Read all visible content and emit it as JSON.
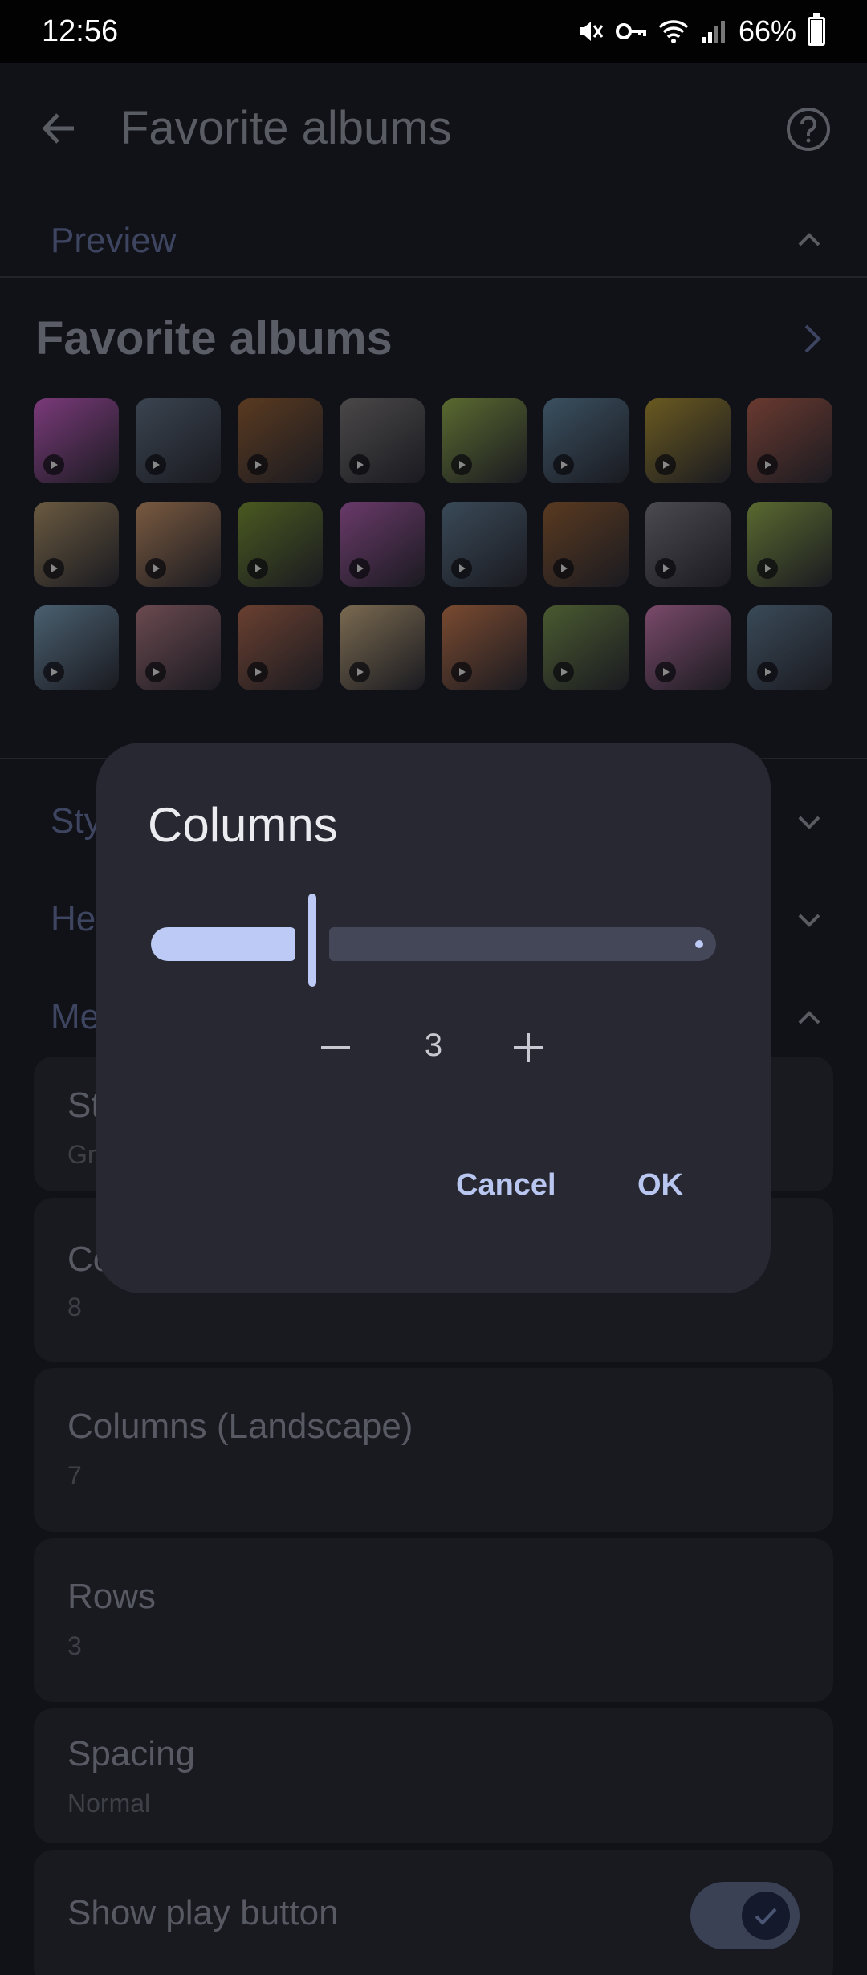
{
  "status_bar": {
    "time": "12:56",
    "battery": "66%"
  },
  "app_bar": {
    "title": "Favorite albums"
  },
  "sections": {
    "preview": "Preview",
    "style": "Sty",
    "header": "He",
    "media": "Me"
  },
  "preview": {
    "title": "Favorite albums"
  },
  "settings": {
    "style": {
      "title": "St",
      "value": "Gr"
    },
    "columns": {
      "title": "Co",
      "value": "8"
    },
    "columns_landscape": {
      "title": "Columns (Landscape)",
      "value": "7"
    },
    "rows": {
      "title": "Rows",
      "value": "3"
    },
    "spacing": {
      "title": "Spacing",
      "value": "Normal"
    },
    "show_play_button": {
      "title": "Show play button",
      "enabled": true
    }
  },
  "dialog": {
    "title": "Columns",
    "value": "3",
    "slider_fraction": 0.25,
    "cancel_label": "Cancel",
    "ok_label": "OK"
  },
  "colors": {
    "accent": "#bccaf5",
    "dialog_bg": "#272831",
    "page_bg": "#111218"
  },
  "thumbnails": [
    "#7a3a7a",
    "#3a4450",
    "#5a3a20",
    "#4a4848",
    "#5a6a30",
    "#3a5060",
    "#6a5a20",
    "#6a3a30",
    "#6a5a40",
    "#7a5a40",
    "#4a5a20",
    "#6a3a6a",
    "#3a4a58",
    "#5a3a20",
    "#4a4a50",
    "#5a6a30",
    "#4a6070",
    "#6a4a50",
    "#6a4030",
    "#7a6a50",
    "#7a4a30",
    "#4a5a30",
    "#7a4a6a",
    "#3a4a58"
  ]
}
